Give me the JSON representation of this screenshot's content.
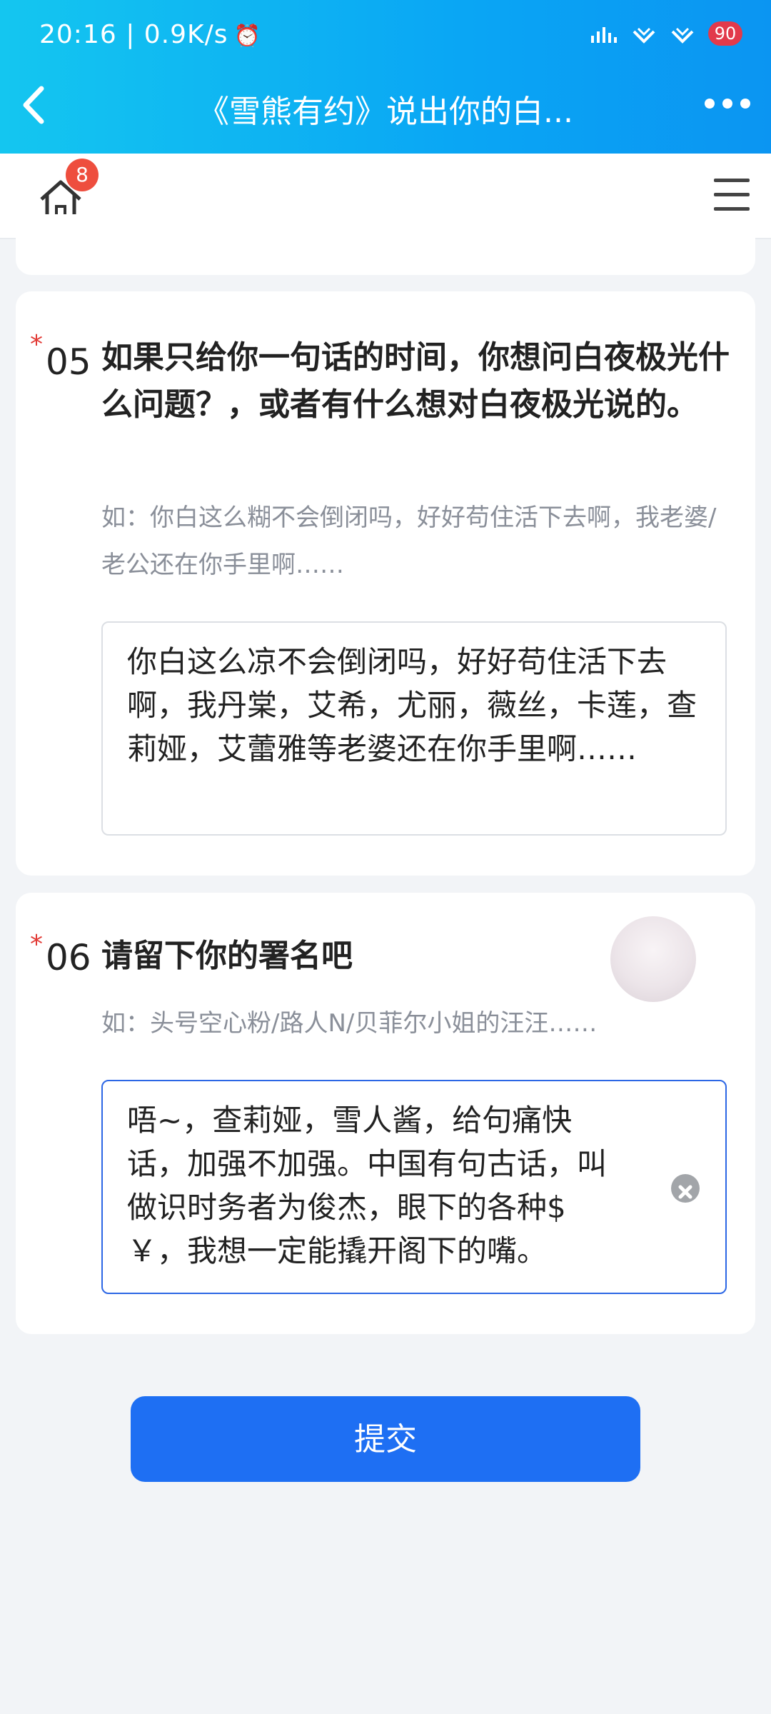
{
  "status_bar": {
    "time": "20:16 | 0.9K/s",
    "battery": "90"
  },
  "header": {
    "title": "《雪熊有约》说出你的白..."
  },
  "toolbar": {
    "home_badge": "8"
  },
  "questions": [
    {
      "required_mark": "*",
      "number": "05",
      "title": "如果只给你一句话的时间，你想问白夜极光什么问题？，或者有什么想对白夜极光说的。",
      "hint": "如：你白这么糊不会倒闭吗，好好苟住活下去啊，我老婆/老公还在你手里啊……",
      "answer": "你白这么凉不会倒闭吗，好好苟住活下去啊，我丹棠，艾希，尤丽，薇丝，卡莲，查莉娅，艾蕾雅等老婆还在你手里啊……"
    },
    {
      "required_mark": "*",
      "number": "06",
      "title": "请留下你的署名吧",
      "hint": "如：头号空心粉/路人N/贝菲尔小姐的汪汪……",
      "answer": "唔~，查莉娅，雪人酱，给句痛快话，加强不加强。中国有句古话，叫做识时务者为俊杰，眼下的各种$￥，我想一定能撬开阁下的嘴。"
    }
  ],
  "submit_label": "提交",
  "colors": {
    "header_gradient_start": "#14c6f0",
    "header_gradient_end": "#0b95f2",
    "submit_button": "#1e6ff3",
    "required_star": "#e23a35",
    "focused_border": "#2c67e5",
    "badge": "#ee4e3e"
  }
}
